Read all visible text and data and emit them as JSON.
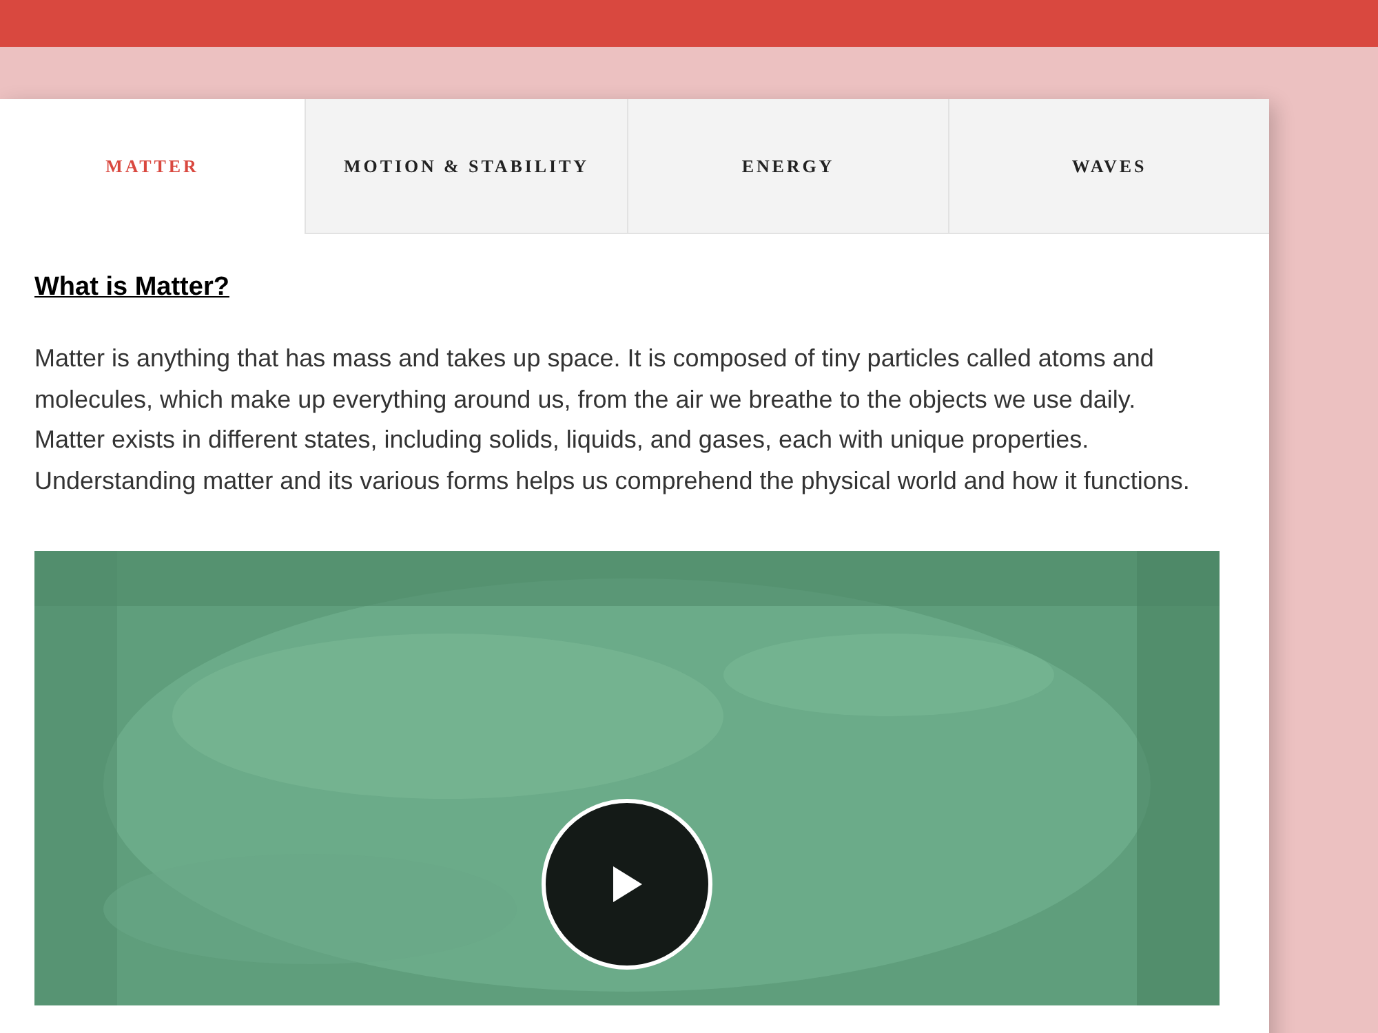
{
  "tabs": [
    {
      "label": "MATTER",
      "selected": true
    },
    {
      "label": "MOTION & STABILITY",
      "selected": false
    },
    {
      "label": "ENERGY",
      "selected": false
    },
    {
      "label": "WAVES",
      "selected": false
    }
  ],
  "content": {
    "heading": "What is Matter?",
    "paragraph": "Matter is anything that has mass and takes up space. It is composed of tiny particles called atoms and molecules, which make up everything around us, from the air we breathe to the objects we use daily. Matter exists in different states, including solids, liquids, and gases, each with unique properties. Understanding matter and its various forms helps us comprehend the physical world and how it functions."
  }
}
